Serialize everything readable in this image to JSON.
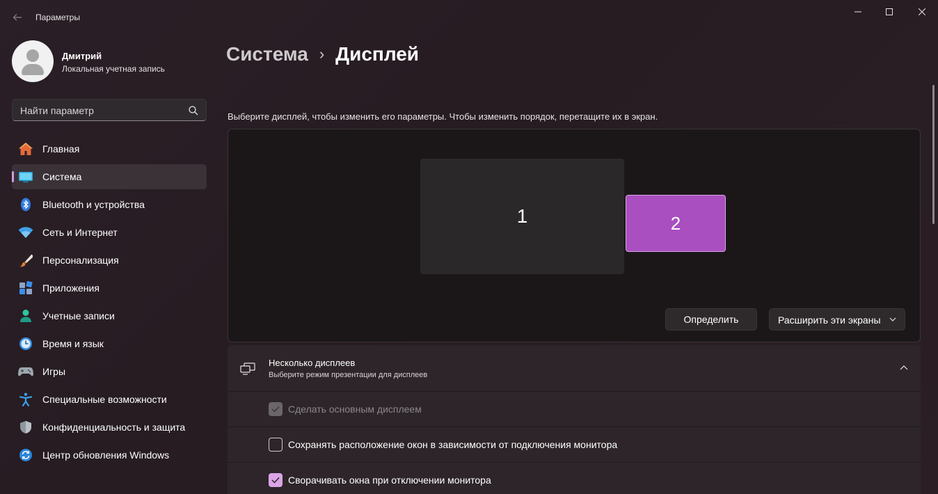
{
  "window": {
    "title": "Параметры"
  },
  "profile": {
    "name": "Дмитрий",
    "account_type": "Локальная учетная запись"
  },
  "search": {
    "placeholder": "Найти параметр"
  },
  "nav": {
    "items": [
      {
        "label": "Главная",
        "icon": "home-icon",
        "active": false
      },
      {
        "label": "Система",
        "icon": "system-icon",
        "active": true
      },
      {
        "label": "Bluetooth и устройства",
        "icon": "bluetooth-icon",
        "active": false
      },
      {
        "label": "Сеть и Интернет",
        "icon": "network-icon",
        "active": false
      },
      {
        "label": "Персонализация",
        "icon": "brush-icon",
        "active": false
      },
      {
        "label": "Приложения",
        "icon": "apps-icon",
        "active": false
      },
      {
        "label": "Учетные записи",
        "icon": "accounts-icon",
        "active": false
      },
      {
        "label": "Время и язык",
        "icon": "time-language-icon",
        "active": false
      },
      {
        "label": "Игры",
        "icon": "gaming-icon",
        "active": false
      },
      {
        "label": "Специальные возможности",
        "icon": "accessibility-icon",
        "active": false
      },
      {
        "label": "Конфиденциальность и защита",
        "icon": "privacy-shield-icon",
        "active": false
      },
      {
        "label": "Центр обновления Windows",
        "icon": "windows-update-icon",
        "active": false
      }
    ]
  },
  "breadcrumb": {
    "parent": "Система",
    "separator": "›",
    "current": "Дисплей"
  },
  "display": {
    "hint": "Выберите дисплей, чтобы изменить его параметры. Чтобы изменить порядок, перетащите их в экран.",
    "monitors": [
      {
        "number": "1",
        "selected": false
      },
      {
        "number": "2",
        "selected": true
      }
    ],
    "identify_button": "Определить",
    "mode_dropdown": "Расширить эти экраны"
  },
  "multiple_displays": {
    "title": "Несколько дисплеев",
    "subtitle": "Выберите режим презентации для дисплеев",
    "expanded": true,
    "options": [
      {
        "label": "Сделать основным дисплеем",
        "checked": true,
        "disabled": true
      },
      {
        "label": "Сохранять расположение окон в зависимости от подключения монитора",
        "checked": false,
        "disabled": false
      },
      {
        "label": "Сворачивать окна при отключении монитора",
        "checked": true,
        "disabled": false
      }
    ]
  },
  "colors": {
    "accent": "#d9a5e6",
    "selected_monitor": "#a94fc0",
    "background": "#271d23"
  }
}
